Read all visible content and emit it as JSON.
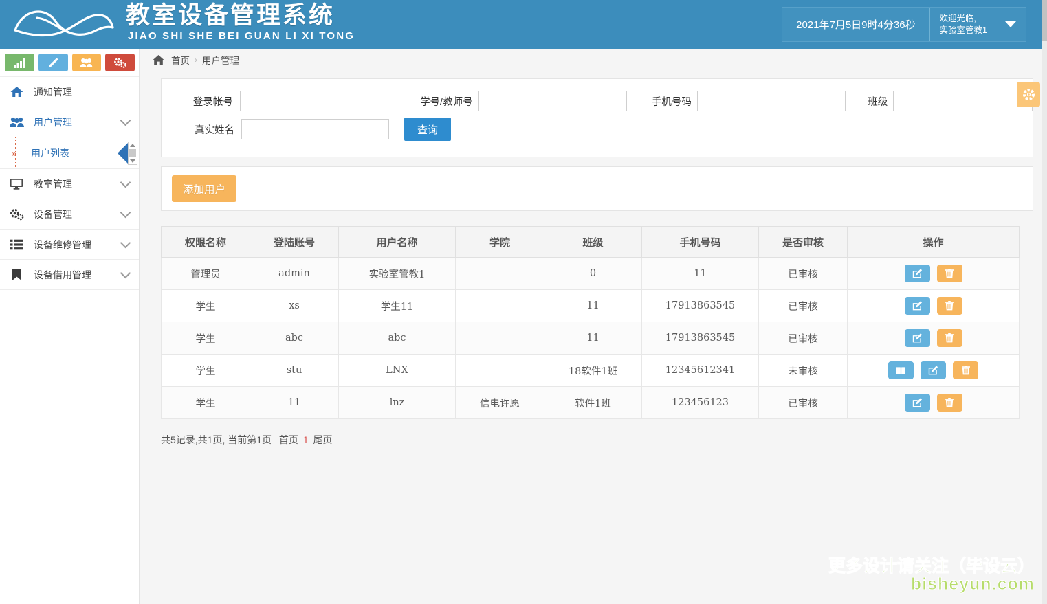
{
  "header": {
    "brand_title": "教室设备管理系统",
    "brand_subtitle": "JIAO SHI SHE BEI GUAN LI XI TONG",
    "datetime": "2021年7月5日9时4分36秒",
    "welcome_line1": "欢迎光临,",
    "welcome_line2": "实验室管教1",
    "accent_color": "#3c8dbc"
  },
  "sidebar": {
    "quick_icons": [
      {
        "name": "chart-icon",
        "color": "#78b86c"
      },
      {
        "name": "pencil-icon",
        "color": "#62b0de"
      },
      {
        "name": "users-icon",
        "color": "#f8b552"
      },
      {
        "name": "gears-icon",
        "color": "#cf4b3c"
      }
    ],
    "items": [
      {
        "label": "通知管理",
        "icon": "home-icon",
        "has_chevron": false,
        "active": false
      },
      {
        "label": "用户管理",
        "icon": "users-icon",
        "has_chevron": true,
        "active": true
      },
      {
        "label": "教室管理",
        "icon": "monitor-icon",
        "has_chevron": true,
        "active": false
      },
      {
        "label": "设备管理",
        "icon": "gears-icon",
        "has_chevron": true,
        "active": false
      },
      {
        "label": "设备维修管理",
        "icon": "list-icon",
        "has_chevron": true,
        "active": false
      },
      {
        "label": "设备借用管理",
        "icon": "bookmark-icon",
        "has_chevron": true,
        "active": false
      }
    ],
    "submenu": {
      "label": "用户列表",
      "marker": "»"
    }
  },
  "breadcrumb": {
    "home_icon": "home-icon",
    "home": "首页",
    "separator": "›",
    "current": "用户管理"
  },
  "search_form": {
    "fields": [
      {
        "label": "登录帐号",
        "value": "",
        "placeholder": ""
      },
      {
        "label": "学号/教师号",
        "value": "",
        "placeholder": ""
      },
      {
        "label": "手机号码",
        "value": "",
        "placeholder": ""
      },
      {
        "label": "班级",
        "value": "",
        "placeholder": ""
      },
      {
        "label": "真实姓名",
        "value": "",
        "placeholder": ""
      }
    ],
    "query_button": "查询",
    "settings_icon": "gear-icon"
  },
  "toolbar": {
    "add_user_label": "添加用户"
  },
  "table": {
    "columns": [
      "权限名称",
      "登陆账号",
      "用户名称",
      "学院",
      "班级",
      "手机号码",
      "是否审核",
      "操作"
    ],
    "rows": [
      {
        "role": "管理员",
        "account": "admin",
        "username": "实验室管教1",
        "college": "",
        "class": "0",
        "phone": "11",
        "audit": "已审核",
        "audited": true,
        "actions": [
          "edit-button",
          "delete-button"
        ]
      },
      {
        "role": "学生",
        "account": "xs",
        "username": "学生11",
        "college": "",
        "class": "11",
        "phone": "17913863545",
        "audit": "已审核",
        "audited": true,
        "actions": [
          "edit-button",
          "delete-button"
        ]
      },
      {
        "role": "学生",
        "account": "abc",
        "username": "abc",
        "college": "",
        "class": "11",
        "phone": "17913863545",
        "audit": "已审核",
        "audited": true,
        "actions": [
          "edit-button",
          "delete-button"
        ]
      },
      {
        "role": "学生",
        "account": "stu",
        "username": "LNX",
        "college": "",
        "class": "18软件1班",
        "phone": "12345612341",
        "audit": "未审核",
        "audited": false,
        "actions": [
          "review-button",
          "edit-button",
          "delete-button"
        ]
      },
      {
        "role": "学生",
        "account": "11",
        "username": "lnz",
        "college": "信电许愿",
        "class": "软件1班",
        "phone": "123456123",
        "audit": "已审核",
        "audited": true,
        "actions": [
          "edit-button",
          "delete-button"
        ]
      }
    ]
  },
  "pagination": {
    "summary": "共5记录,共1页, 当前第1页",
    "first": "首页",
    "current_page": "1",
    "last": "尾页"
  },
  "watermark": {
    "line1": "更多设计请关注（毕设云）",
    "line2": "bisheyun.com",
    "color": "#9ed34a"
  }
}
